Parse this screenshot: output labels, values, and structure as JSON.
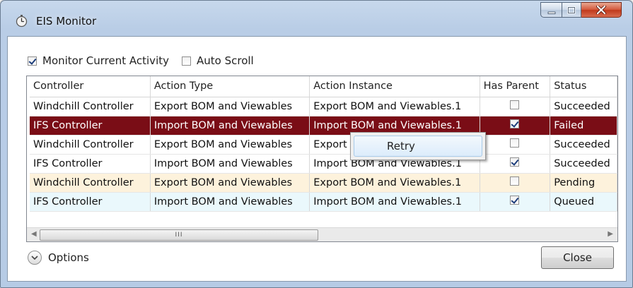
{
  "window": {
    "title": "EIS Monitor"
  },
  "toolbar": {
    "monitor_label": "Monitor Current Activity",
    "monitor_checked": true,
    "autoscroll_label": "Auto Scroll",
    "autoscroll_checked": false
  },
  "table": {
    "columns": [
      "Controller",
      "Action Type",
      "Action Instance",
      "Has Parent",
      "Status"
    ],
    "rows": [
      {
        "controller": "Windchill Controller",
        "action_type": "Export BOM and Viewables",
        "action_instance": "Export BOM and Viewables.1",
        "has_parent": false,
        "status": "Succeeded"
      },
      {
        "controller": "IFS Controller",
        "action_type": "Import BOM and Viewables",
        "action_instance": "Import BOM and Viewables.1",
        "has_parent": true,
        "status": "Failed"
      },
      {
        "controller": "Windchill Controller",
        "action_type": "Export BOM and Viewables",
        "action_instance": "Export BOM and Viewables.1",
        "has_parent": false,
        "status": "Succeeded"
      },
      {
        "controller": "IFS Controller",
        "action_type": "Import BOM and Viewables",
        "action_instance": "Import BOM and Viewables.1",
        "has_parent": true,
        "status": "Succeeded"
      },
      {
        "controller": "Windchill Controller",
        "action_type": "Export BOM and Viewables",
        "action_instance": "Export BOM and Viewables.1",
        "has_parent": false,
        "status": "Pending"
      },
      {
        "controller": "IFS Controller",
        "action_type": "Import BOM and Viewables",
        "action_instance": "Import BOM and Viewables.1",
        "has_parent": true,
        "status": "Queued"
      }
    ]
  },
  "context_menu": {
    "retry_label": "Retry"
  },
  "scrollbar": {
    "grip": "III"
  },
  "footer": {
    "options_label": "Options",
    "close_label": "Close"
  },
  "colors": {
    "selected_row": "#7a0d16",
    "pending_row": "#fdf2dc",
    "queued_row": "#eaf8fc",
    "title_bar": "#b9cde6"
  },
  "icons": [
    "stopwatch-icon",
    "minimize-icon",
    "maximize-icon",
    "close-icon",
    "chevron-down-icon",
    "scroll-left-icon",
    "scroll-right-icon"
  ]
}
